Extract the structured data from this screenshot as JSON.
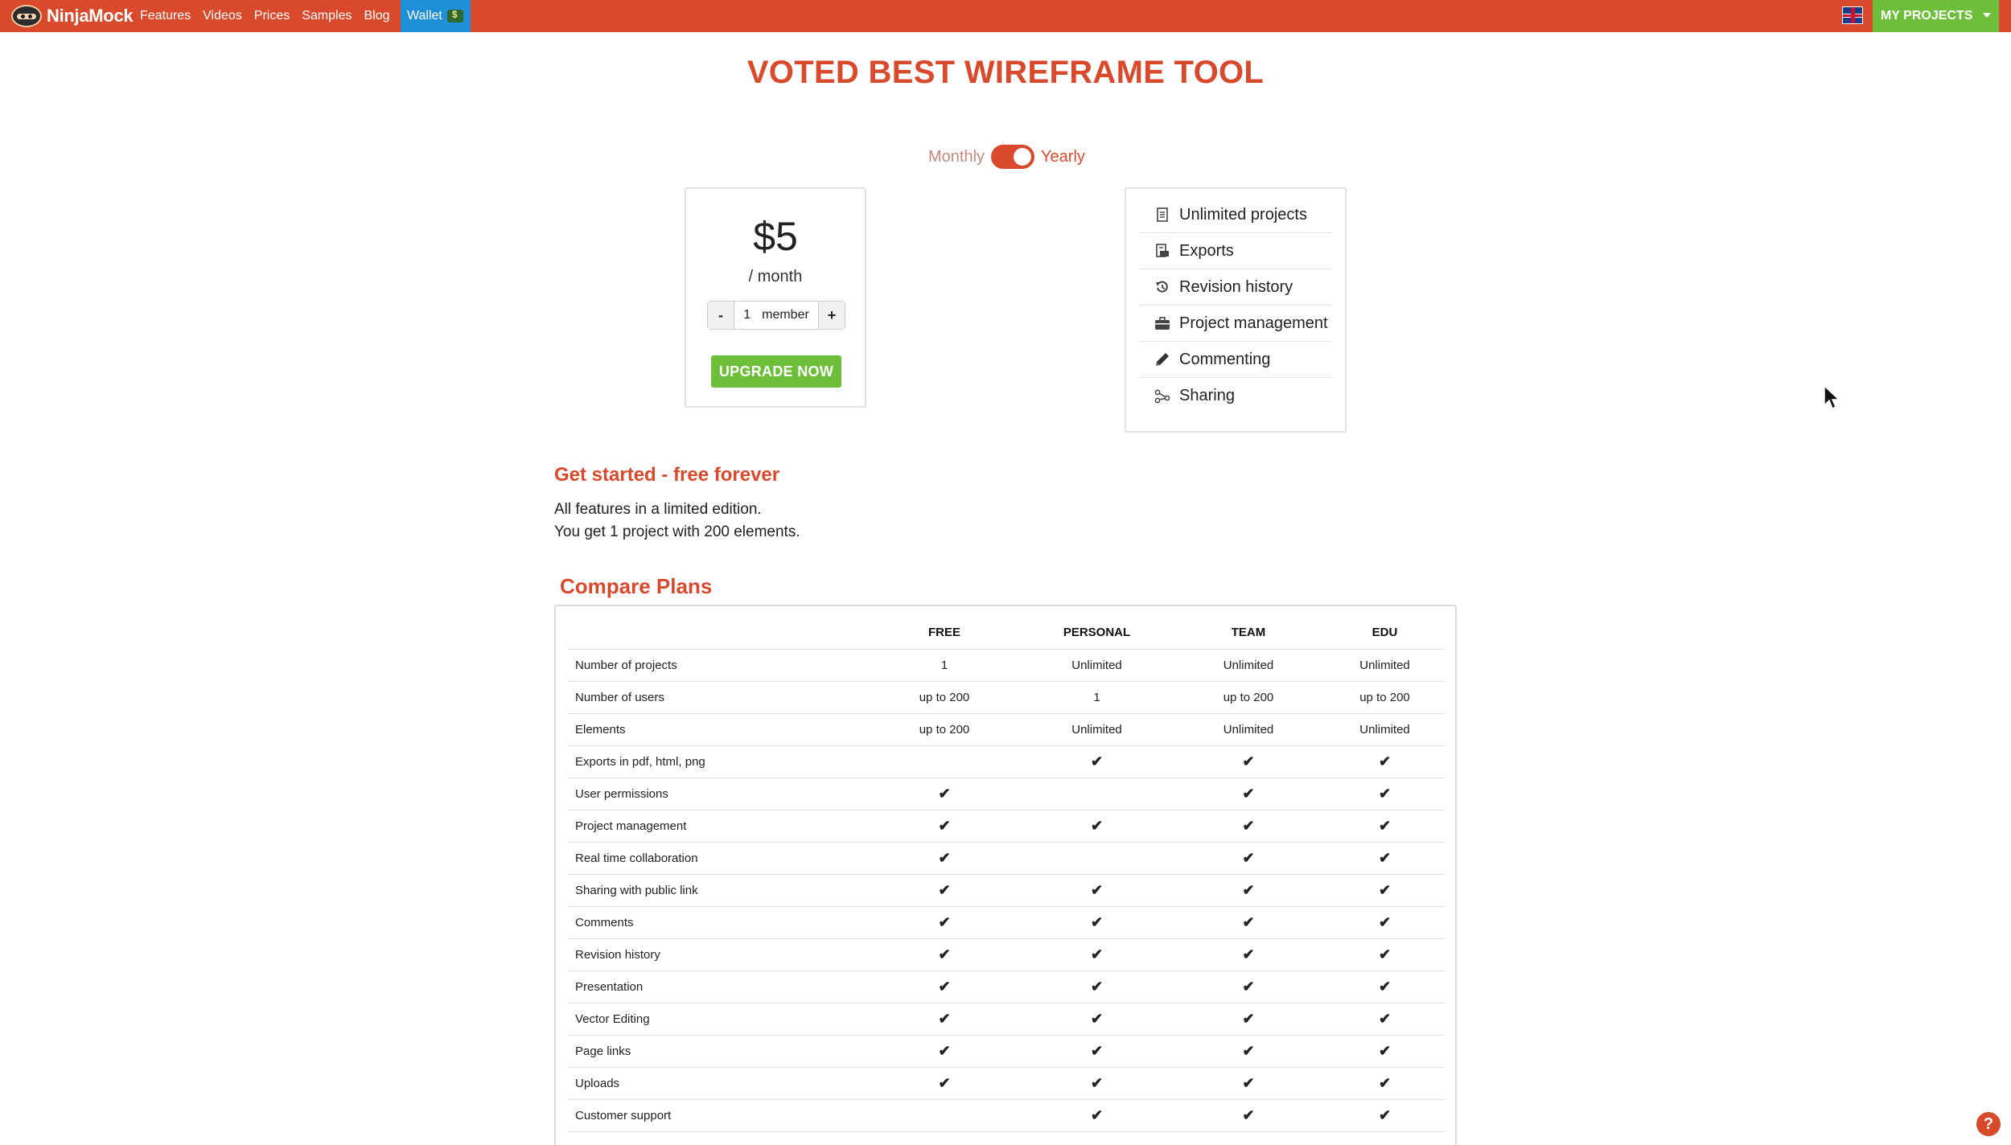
{
  "header": {
    "logo_text": "NinjaMock",
    "nav": [
      "Features",
      "Videos",
      "Prices",
      "Samples",
      "Blog"
    ],
    "wallet_label": "Wallet",
    "my_projects_label": "MY PROJECTS"
  },
  "headline": "VOTED BEST WIREFRAME TOOL",
  "billing": {
    "monthly_label": "Monthly",
    "yearly_label": "Yearly",
    "selected": "Yearly"
  },
  "price_card": {
    "price": "$5",
    "period": "/ month",
    "minus_label": "-",
    "plus_label": "+",
    "member_count": "1",
    "member_label": "member",
    "upgrade_label": "UPGRADE NOW"
  },
  "features": [
    {
      "label": "Unlimited projects",
      "icon": "document-icon"
    },
    {
      "label": "Exports",
      "icon": "export-icon"
    },
    {
      "label": "Revision history",
      "icon": "history-icon"
    },
    {
      "label": "Project management",
      "icon": "briefcase-icon"
    },
    {
      "label": "Commenting",
      "icon": "pencil-icon"
    },
    {
      "label": "Sharing",
      "icon": "share-icon"
    }
  ],
  "free_section": {
    "title": "Get started - free forever",
    "line1": "All features in a limited edition.",
    "line2": "You get 1 project with 200 elements."
  },
  "compare": {
    "title": "Compare Plans",
    "columns": [
      "FREE",
      "PERSONAL",
      "TEAM",
      "EDU"
    ],
    "rows": [
      {
        "label": "Number of projects",
        "cells": [
          "1",
          "Unlimited",
          "Unlimited",
          "Unlimited"
        ]
      },
      {
        "label": "Number of users",
        "cells": [
          "up to 200",
          "1",
          "up to 200",
          "up to 200"
        ]
      },
      {
        "label": "Elements",
        "cells": [
          "up to 200",
          "Unlimited",
          "Unlimited",
          "Unlimited"
        ]
      },
      {
        "label": "Exports in pdf, html, png",
        "cells": [
          "",
          "✔",
          "✔",
          "✔"
        ]
      },
      {
        "label": "User permissions",
        "cells": [
          "✔",
          "",
          "✔",
          "✔"
        ]
      },
      {
        "label": "Project management",
        "cells": [
          "✔",
          "✔",
          "✔",
          "✔"
        ]
      },
      {
        "label": "Real time collaboration",
        "cells": [
          "✔",
          "",
          "✔",
          "✔"
        ]
      },
      {
        "label": "Sharing with public link",
        "cells": [
          "✔",
          "✔",
          "✔",
          "✔"
        ]
      },
      {
        "label": "Comments",
        "cells": [
          "✔",
          "✔",
          "✔",
          "✔"
        ]
      },
      {
        "label": "Revision history",
        "cells": [
          "✔",
          "✔",
          "✔",
          "✔"
        ]
      },
      {
        "label": "Presentation",
        "cells": [
          "✔",
          "✔",
          "✔",
          "✔"
        ]
      },
      {
        "label": "Vector Editing",
        "cells": [
          "✔",
          "✔",
          "✔",
          "✔"
        ]
      },
      {
        "label": "Page links",
        "cells": [
          "✔",
          "✔",
          "✔",
          "✔"
        ]
      },
      {
        "label": "Uploads",
        "cells": [
          "✔",
          "✔",
          "✔",
          "✔"
        ]
      },
      {
        "label": "Customer support",
        "cells": [
          "",
          "✔",
          "✔",
          "✔"
        ]
      }
    ]
  },
  "help_label": "?",
  "colors": {
    "brand": "#d84a2b",
    "accent_green": "#6dbf3a",
    "wallet_blue": "#1f8fd8"
  }
}
